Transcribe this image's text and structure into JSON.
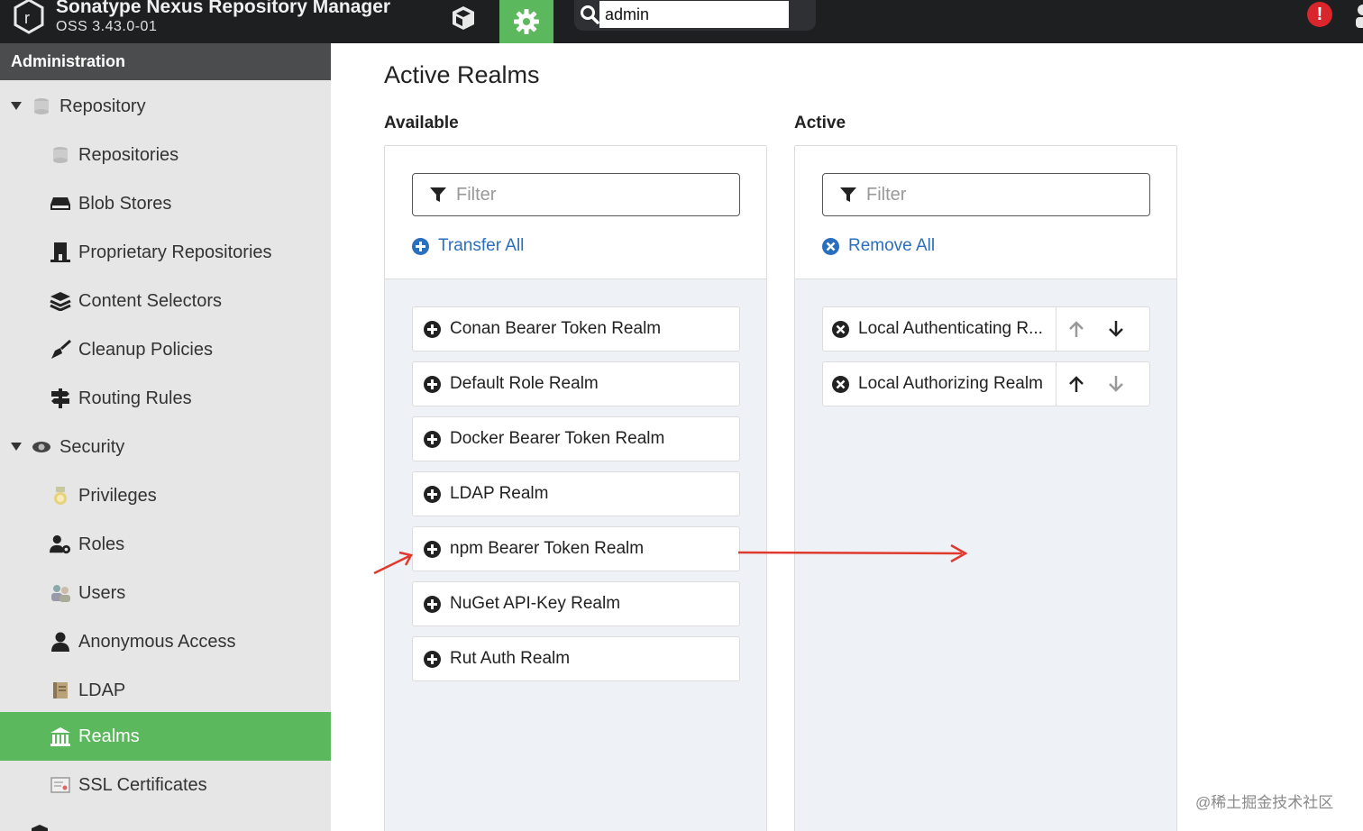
{
  "header": {
    "app_title": "Sonatype Nexus Repository Manager",
    "version": "OSS 3.43.0-01",
    "search_value": "admin",
    "icons": {
      "logo": "nexus-logo-icon",
      "browse": "cube-icon",
      "admin": "gear-icon",
      "search": "search-icon",
      "alert": "alert-icon",
      "user": "user-icon"
    },
    "alert_glyph": "!"
  },
  "sidebar": {
    "title": "Administration",
    "groups": [
      {
        "label": "Repository",
        "icon": "database-icon"
      },
      {
        "label": "Security",
        "icon": "eye-icon"
      }
    ],
    "repository_items": [
      {
        "label": "Repositories",
        "icon": "database-icon"
      },
      {
        "label": "Blob Stores",
        "icon": "hdd-icon"
      },
      {
        "label": "Proprietary Repositories",
        "icon": "building-icon"
      },
      {
        "label": "Content Selectors",
        "icon": "layers-icon"
      },
      {
        "label": "Cleanup Policies",
        "icon": "broom-icon"
      },
      {
        "label": "Routing Rules",
        "icon": "signpost-icon"
      }
    ],
    "security_items": [
      {
        "label": "Privileges",
        "icon": "medal-icon"
      },
      {
        "label": "Roles",
        "icon": "user-gear-icon"
      },
      {
        "label": "Users",
        "icon": "users-icon"
      },
      {
        "label": "Anonymous Access",
        "icon": "user-icon"
      },
      {
        "label": "LDAP",
        "icon": "book-icon"
      },
      {
        "label": "Realms",
        "icon": "realm-icon",
        "active": true
      },
      {
        "label": "SSL Certificates",
        "icon": "certificate-icon"
      }
    ],
    "accent_color": "#5cb85c"
  },
  "main": {
    "title": "Active Realms",
    "available": {
      "label": "Available",
      "filter_placeholder": "Filter",
      "bulk_label": "Transfer All",
      "items": [
        "Conan Bearer Token Realm",
        "Default Role Realm",
        "Docker Bearer Token Realm",
        "LDAP Realm",
        "npm Bearer Token Realm",
        "NuGet API-Key Realm",
        "Rut Auth Realm"
      ]
    },
    "active": {
      "label": "Active",
      "filter_placeholder": "Filter",
      "bulk_label": "Remove All",
      "items": [
        "Local Authenticating R...",
        "Local Authorizing Realm"
      ]
    },
    "link_color": "#2a6fbf",
    "annotation_color": "#e03a2f"
  },
  "watermark": "@稀土掘金技术社区"
}
